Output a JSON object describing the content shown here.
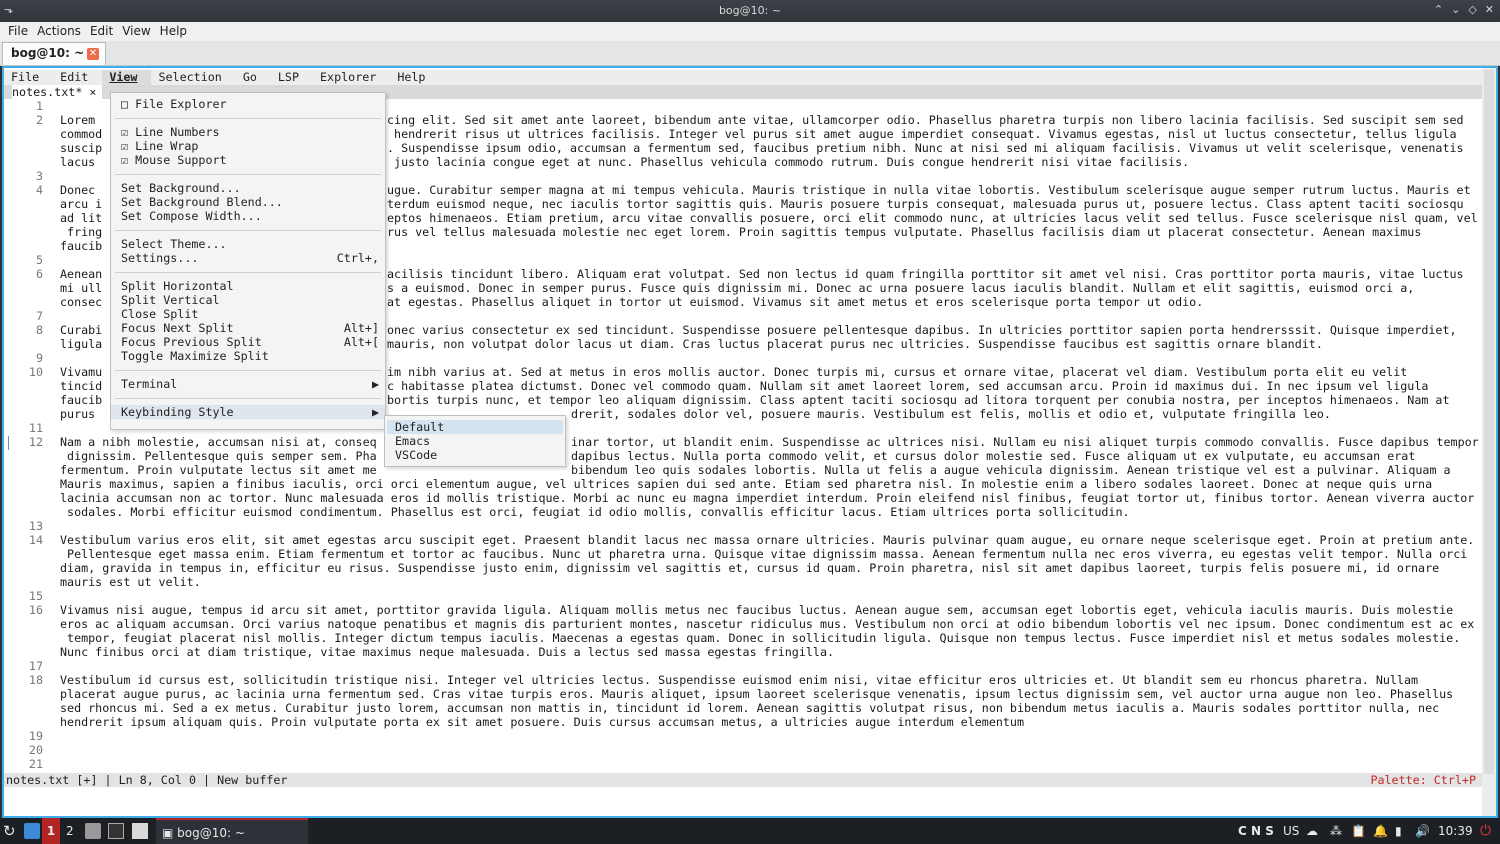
{
  "window": {
    "title": "bog@10: ~"
  },
  "konsole_menu": [
    "File",
    "Actions",
    "Edit",
    "View",
    "Help"
  ],
  "konsole_tab": {
    "label": "bog@10: ~"
  },
  "editor": {
    "menu": [
      "File",
      "Edit",
      "View",
      "Selection",
      "Go",
      "LSP",
      "Explorer",
      "Help"
    ],
    "active_menu": "View",
    "tab": {
      "label": "notes.txt* ×"
    },
    "line_numbers": [
      "1",
      "2",
      "3",
      "4",
      "5",
      "6",
      "7",
      "8",
      "9",
      "10",
      "11",
      "12",
      "13",
      "14",
      "15",
      "16",
      "17",
      "18",
      "19",
      "20",
      "21"
    ],
    "text_lines": [
      "",
      "Lorem",
      "commod",
      "suscip",
      "lacus",
      "",
      "Donec",
      "arcu i",
      "ad lit",
      " fring",
      "faucib",
      "",
      "Aenean",
      "mi ull",
      "consec",
      "",
      "Curabi",
      "ligula",
      "",
      "Vivamu",
      "tincid",
      "faucib",
      "purus",
      "",
      "Nam a nibh molestie, accumsan nisi at, conseq",
      " dignissim. Pellentesque quis semper sem. Pha",
      "fermentum. Proin vulputate lectus sit amet me",
      "Mauris maximus, sapien a finibus iaculis, orci orci elementum augue, vel ultrices sapien dui sed ante. Etiam sed pharetra nisl. In molestie enim a libero sodales laoreet. Donec at neque quis urna",
      "lacinia accumsan non ac tortor. Nunc malesuada eros id mollis tristique. Morbi ac nunc eu magna imperdiet interdum. Proin eleifend nisl finibus, feugiat tortor ut, finibus tortor. Aenean viverra auctor",
      " sodales. Morbi efficitur euismod condimentum. Phasellus est orci, feugiat id odio mollis, convallis efficitur lacus. Etiam ultrices porta sollicitudin.",
      "",
      "Vestibulum varius eros elit, sit amet egestas arcu suscipit eget. Praesent blandit lacus nec massa ornare ultricies. Mauris pulvinar quam augue, eu ornare neque scelerisque eget. Proin at pretium ante.",
      " Pellentesque eget massa enim. Etiam fermentum et tortor ac faucibus. Nunc ut pharetra urna. Quisque vitae dignissim massa. Aenean fermentum nulla nec eros viverra, eu egestas velit tempor. Nulla orci",
      "diam, gravida in tempus in, efficitur eu risus. Suspendisse justo enim, dignissim vel sagittis et, cursus id quam. Proin pharetra, nisl sit amet dapibus laoreet, turpis felis posuere mi, id ornare",
      "mauris est ut velit.",
      "",
      "Vivamus nisi augue, tempus id arcu sit amet, porttitor gravida ligula. Aliquam mollis metus nec faucibus luctus. Aenean augue sem, accumsan eget lobortis eget, vehicula iaculis mauris. Duis molestie",
      "eros ac aliquam accumsan. Orci varius natoque penatibus et magnis dis parturient montes, nascetur ridiculus mus. Vestibulum non orci at odio bibendum lobortis vel nec ipsum. Donec condimentum est ac ex",
      " tempor, feugiat placerat nisl mollis. Integer dictum tempus iaculis. Maecenas a egestas quam. Donec in sollicitudin ligula. Quisque non tempus lectus. Fusce imperdiet nisl et metus sodales molestie.",
      "Nunc finibus orci at diam tristique, vitae maximus neque malesuada. Duis a lectus sed massa egestas fringilla.",
      "",
      "Vestibulum id cursus est, sollicitudin tristique nisi. Integer vel ultricies lectus. Suspendisse euismod enim nisi, vitae efficitur eros ultricies et. Ut blandit sem eu rhoncus pharetra. Nullam",
      "placerat augue purus, ac lacinia urna fermentum sed. Cras vitae turpis eros. Mauris aliquet, ipsum laoreet scelerisque venenatis, ipsum lectus dignissim sem, vel auctor urna augue non leo. Phasellus",
      "sed rhoncus mi. Sed a ex metus. Curabitur justo lorem, accumsan non mattis in, tincidunt id lorem. Aenean sagittis volutpat risus, non bibendum metus iaculis a. Mauris sodales porttitor nulla, nec",
      "hendrerit ipsum aliquam quis. Proin vulputate porta ex sit amet posuere. Duis cursus accumsan metus, a ultricies augue interdum elementum",
      "",
      "",
      ""
    ],
    "text_right": [
      "",
      "cing elit. Sed sit amet ante laoreet, bibendum ante vitae, ullamcorper odio. Phasellus pharetra turpis non libero lacinia facilisis. Sed suscipit sem sed",
      " hendrerit risus ut ultrices facilisis. Integer vel purus sit amet augue imperdiet consequat. Vivamus egestas, nisl ut luctus consectetur, tellus ligula",
      ". Suspendisse ipsum odio, accumsan a fermentum sed, faucibus pretium nibh. Nunc at nisi sed mi aliquam facilisis. Vivamus ut velit scelerisque, venenatis",
      " justo lacinia congue eget at nunc. Phasellus vehicula commodo rutrum. Duis congue hendrerit nisi vitae facilisis.",
      "",
      "ugue. Curabitur semper magna at mi tempus vehicula. Mauris tristique in nulla vitae lobortis. Vestibulum scelerisque augue semper rutrum luctus. Mauris et",
      "terdum euismod neque, nec iaculis tortor sagittis quis. Mauris posuere turpis consequat, malesuada purus ut, posuere lectus. Class aptent taciti sociosqu",
      "eptos himenaeos. Etiam pretium, arcu vitae convallis posuere, orci elit commodo nunc, at ultricies lacus velit sed tellus. Fusce scelerisque nisl quam, vel",
      "rus vel tellus malesuada molestie nec eget lorem. Proin sagittis tempus vulputate. Phasellus facilisis diam ut placerat consectetur. Aenean maximus",
      "",
      "",
      "acilisis tincidunt libero. Aliquam erat volutpat. Sed non lectus id quam fringilla porttitor sit amet vel nisi. Cras porttitor porta mauris, vitae luctus",
      "s a euismod. Donec in semper purus. Fusce quis dignissim mi. Donec ac urna posuere lacus iaculis blandit. Nullam et elit sagittis, euismod orci a,",
      "at egestas. Phasellus aliquet in tortor ut euismod. Vivamus sit amet metus et eros scelerisque porta tempor ut odio.",
      "",
      "onec varius consectetur ex sed tincidunt. Suspendisse posuere pellentesque dapibus. In ultricies porttitor sapien porta hendrersssit. Quisque imperdiet,",
      "mauris, non volutpat dolor lacus ut diam. Cras luctus placerat purus nec ultricies. Suspendisse faucibus est sagittis ornare blandit.",
      "",
      "im nibh varius at. Sed at metus in eros mollis auctor. Donec turpis mi, cursus et ornare vitae, placerat vel diam. Vestibulum porta elit eu velit",
      "c habitasse platea dictumst. Donec vel commodo quam. Nullam sit amet laoreet lorem, sed accumsan arcu. Proin id maximus dui. In nec ipsum vel ligula",
      "bortis turpis nunc, et tempor leo aliquam dignissim. Class aptent taciti sociosqu ad litora torquent per conubia nostra, per inceptos himenaeos. Nam at",
      "",
      "",
      "inar tortor, ut blandit enim. Suspendisse ac ultrices nisi. Nullam eu nisi aliquet turpis commodo convallis. Fusce dapibus tempor",
      "dapibus lectus. Nulla porta commodo velit, et cursus dolor molestie sed. Fusce aliquam ut ex vulputate, eu accumsan erat",
      "bibendum leo quis sodales lobortis. Nulla ut felis a augue vehicula dignissim. Aenean tristique vel est a pulvinar. Aliquam a"
    ],
    "line22_partial": "drerit, sodales dolor vel, posuere mauris. Vestibulum est felis, mollis et odio et, vulputate fringilla leo.",
    "status_left": "notes.txt [+] | Ln 8, Col 0 | New buffer",
    "status_right": "Palette: Ctrl+P"
  },
  "view_menu": {
    "items": [
      {
        "label": "□ File Explorer",
        "shortcut": ""
      },
      {
        "label": "☑ Line Numbers",
        "shortcut": ""
      },
      {
        "label": "☑ Line Wrap",
        "shortcut": ""
      },
      {
        "label": "☑ Mouse Support",
        "shortcut": ""
      },
      {
        "label": "Set Background...",
        "shortcut": ""
      },
      {
        "label": "Set Background Blend...",
        "shortcut": ""
      },
      {
        "label": "Set Compose Width...",
        "shortcut": ""
      },
      {
        "label": "Select Theme...",
        "shortcut": ""
      },
      {
        "label": "Settings...",
        "shortcut": "Ctrl+,"
      },
      {
        "label": "Split Horizontal",
        "shortcut": ""
      },
      {
        "label": "Split Vertical",
        "shortcut": ""
      },
      {
        "label": "Close Split",
        "shortcut": ""
      },
      {
        "label": "Focus Next Split",
        "shortcut": "Alt+]"
      },
      {
        "label": "Focus Previous Split",
        "shortcut": "Alt+["
      },
      {
        "label": "Toggle Maximize Split",
        "shortcut": ""
      },
      {
        "label": "Terminal",
        "shortcut": "▶"
      },
      {
        "label": "Keybinding Style",
        "shortcut": "▶"
      }
    ]
  },
  "keybinding_submenu": {
    "items": [
      "Default",
      "Emacs",
      "VSCode"
    ],
    "selected": "Default"
  },
  "taskbar": {
    "workspaces": [
      "1",
      "2"
    ],
    "task_label": "bog@10: ~",
    "tray_text": "C N S",
    "keyboard_layout": "US",
    "clock": "10:39"
  }
}
